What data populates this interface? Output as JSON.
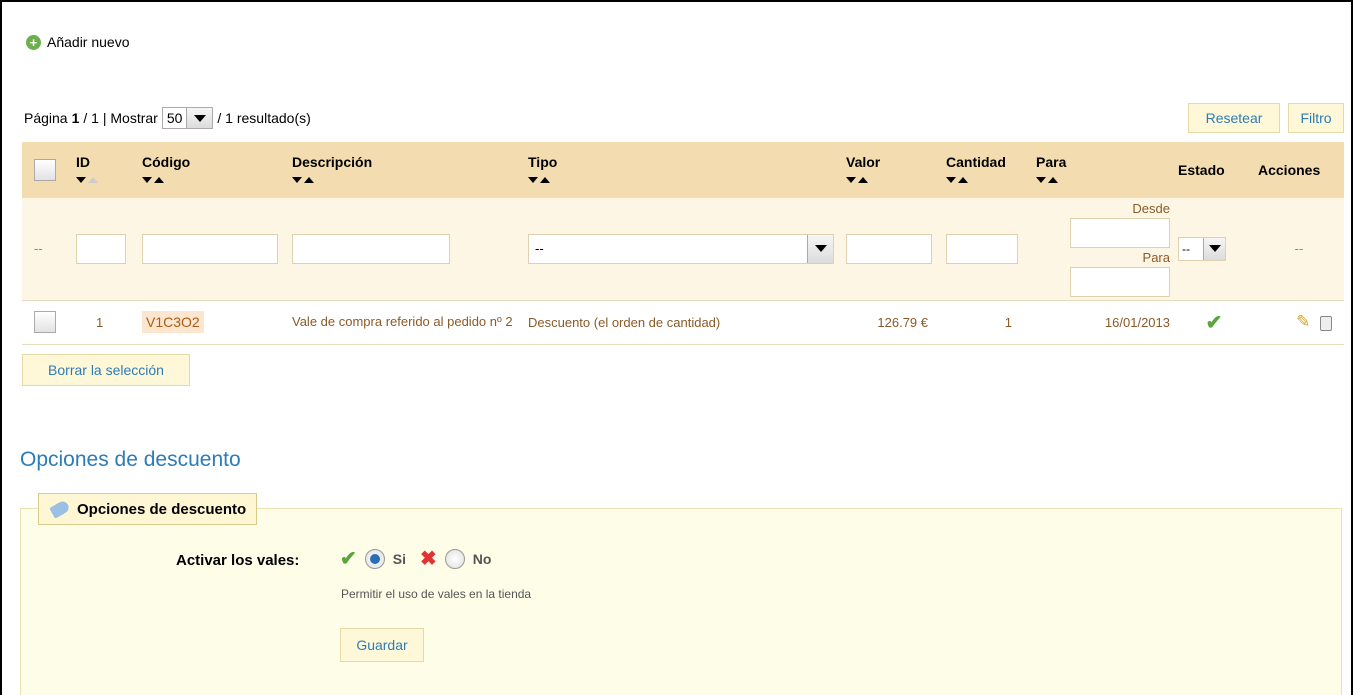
{
  "toolbar": {
    "add_new": "Añadir nuevo"
  },
  "pager": {
    "prefix": "Página",
    "page": "1",
    "total": "/ 1 | Mostrar",
    "per_page": "50",
    "results": "/ 1 resultado(s)"
  },
  "buttons": {
    "reset": "Resetear",
    "filter": "Filtro",
    "delete_selected": "Borrar la selección",
    "save": "Guardar"
  },
  "table": {
    "headers": {
      "id": "ID",
      "code": "Código",
      "description": "Descripción",
      "type": "Tipo",
      "value": "Valor",
      "quantity": "Cantidad",
      "to": "Para",
      "status": "Estado",
      "actions": "Acciones"
    },
    "filter": {
      "placeholder_dash": "--",
      "type_select": "--",
      "status_select": "--",
      "from_label": "Desde",
      "to_label": "Para",
      "actions_dash": "--"
    },
    "rows": [
      {
        "id": "1",
        "code": "V1C3O2",
        "description": "Vale de compra referido al pedido nº 2",
        "type": "Descuento (el orden de cantidad)",
        "value": "126.79 €",
        "quantity": "1",
        "date": "16/01/2013"
      }
    ]
  },
  "section": {
    "title": "Opciones de descuento",
    "legend": "Opciones de descuento"
  },
  "options": {
    "label": "Activar los vales:",
    "yes": "Si",
    "no": "No",
    "hint": "Permitir el uso de vales en la tienda",
    "selected": "yes"
  },
  "colors": {
    "header_bg": "#f3ddb0",
    "link_blue": "#2c7cb8",
    "panel_bg": "#fefde8"
  }
}
